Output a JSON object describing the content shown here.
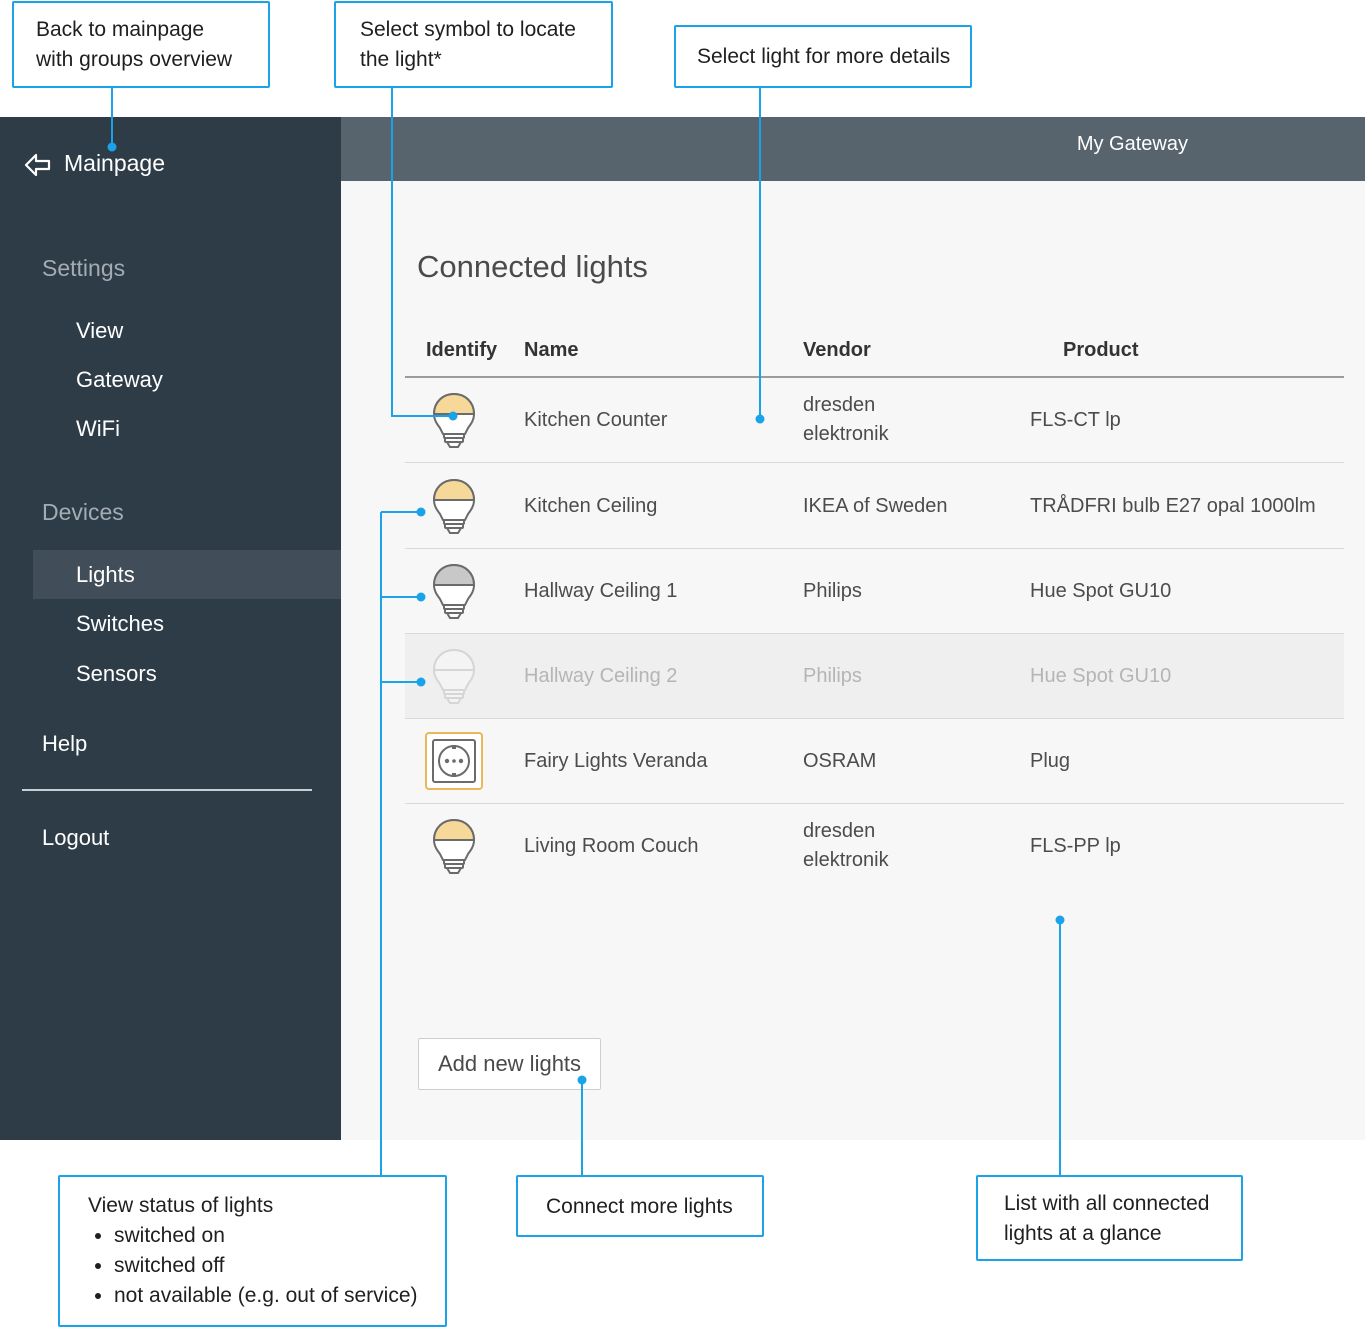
{
  "sidebar": {
    "back_label": "Mainpage",
    "settings_heading": "Settings",
    "settings_items": [
      "View",
      "Gateway",
      "WiFi"
    ],
    "devices_heading": "Devices",
    "device_items": [
      "Lights",
      "Switches",
      "Sensors"
    ],
    "active_item": "Lights",
    "help_label": "Help",
    "logout_label": "Logout"
  },
  "header": {
    "gateway_name": "My Gateway"
  },
  "main": {
    "title": "Connected lights",
    "columns": {
      "identify": "Identify",
      "name": "Name",
      "vendor": "Vendor",
      "product": "Product"
    },
    "lights": [
      {
        "icon": "bulb-on-icon",
        "name": "Kitchen Counter",
        "vendor_lines": [
          "dresden",
          "elektronik"
        ],
        "product": "FLS-CT lp",
        "status": "on"
      },
      {
        "icon": "bulb-on-icon",
        "name": "Kitchen Ceiling",
        "vendor_lines": [
          "IKEA of Sweden"
        ],
        "product": "TRÅDFRI bulb E27 opal 1000lm",
        "status": "on"
      },
      {
        "icon": "bulb-off-icon",
        "name": "Hallway Ceiling 1",
        "vendor_lines": [
          "Philips"
        ],
        "product": "Hue Spot GU10",
        "status": "off"
      },
      {
        "icon": "bulb-unavailable-icon",
        "name": "Hallway Ceiling 2",
        "vendor_lines": [
          "Philips"
        ],
        "product": "Hue Spot GU10",
        "status": "not available"
      },
      {
        "icon": "plug-icon",
        "name": "Fairy Lights Veranda",
        "vendor_lines": [
          "OSRAM"
        ],
        "product": "Plug",
        "status": "on"
      },
      {
        "icon": "bulb-on-icon",
        "name": "Living Room Couch",
        "vendor_lines": [
          "dresden",
          "elektronik"
        ],
        "product": "FLS-PP lp",
        "status": "on"
      }
    ],
    "add_button_label": "Add new lights"
  },
  "callouts": {
    "back": [
      "Back to mainpage",
      "with groups overview"
    ],
    "identify": [
      "Select symbol to locate",
      "the light*"
    ],
    "details": [
      "Select light for more details"
    ],
    "status_title": "View status of lights",
    "status_items": [
      "switched on",
      "switched off",
      "not available (e.g. out of service)"
    ],
    "connect": [
      "Connect more lights"
    ],
    "list": [
      "List with all connected",
      "lights at a glance"
    ]
  },
  "colors": {
    "sidebar_bg": "#2e3c47",
    "header_bg": "#57636d",
    "accent_callout": "#1aa3e8",
    "bulb_on": "#f6d999",
    "bulb_off": "#c8c8c8"
  }
}
